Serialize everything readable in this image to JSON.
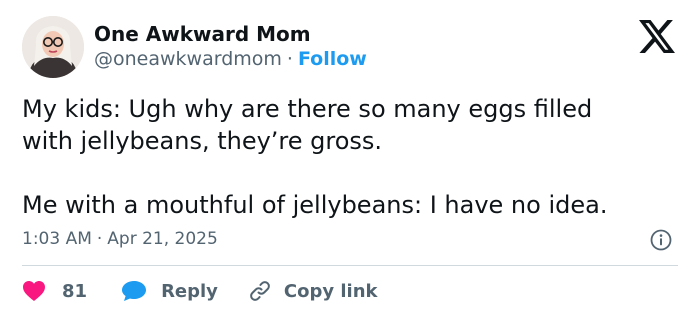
{
  "author": {
    "name": "One Awkward Mom",
    "handle": "@oneawkwardmom",
    "separator": "·",
    "follow_label": "Follow"
  },
  "tweet": {
    "lines": [
      "My kids: Ugh why are there so many eggs filled",
      "with jellybeans, they’re gross.",
      "Me with a mouthful of jellybeans: I have no idea."
    ],
    "time": "1:03 AM",
    "separator": "·",
    "date": "Apr 21, 2025"
  },
  "actions": {
    "like_count": "81",
    "reply_label": "Reply",
    "copy_link_label": "Copy link"
  },
  "icons": {
    "brand": "x-logo-icon",
    "info": "info-icon",
    "like": "heart-icon",
    "reply": "speech-bubble-icon",
    "copy": "link-icon"
  },
  "colors": {
    "accent": "#1d9bf0",
    "like": "#f91880",
    "text": "#0f1419",
    "muted": "#536471",
    "divider": "#cfd9de"
  }
}
